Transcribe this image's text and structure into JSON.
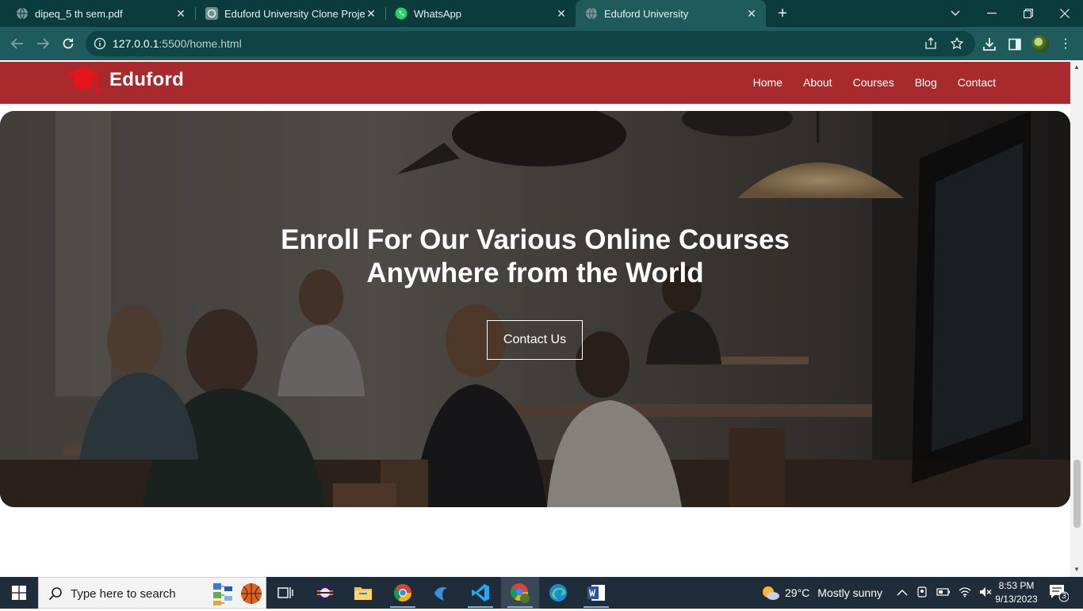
{
  "browser": {
    "tabs": [
      {
        "title": "dipeq_5 th sem.pdf",
        "icon": "globe-icon",
        "active": false
      },
      {
        "title": "Eduford University Clone Project",
        "icon": "chatgpt-icon",
        "active": false
      },
      {
        "title": "WhatsApp",
        "icon": "whatsapp-icon",
        "active": false
      },
      {
        "title": "Eduford University",
        "icon": "globe-icon",
        "active": true
      }
    ],
    "url_host": "127.0.0.1",
    "url_rest": ":5500/home.html"
  },
  "site": {
    "brand": "Eduford",
    "nav": [
      "Home",
      "About",
      "Courses",
      "Blog",
      "Contact"
    ],
    "hero_line1": "Enroll For Our Various Online Courses",
    "hero_line2": "Anywhere from the World",
    "hero_button": "Contact Us",
    "brand_color": "#a82a2c"
  },
  "taskbar": {
    "search_placeholder": "Type here to search",
    "weather_temp": "29°C",
    "weather_text": "Mostly sunny",
    "time": "8:53 PM",
    "date": "9/13/2023",
    "notification_count": "3"
  }
}
